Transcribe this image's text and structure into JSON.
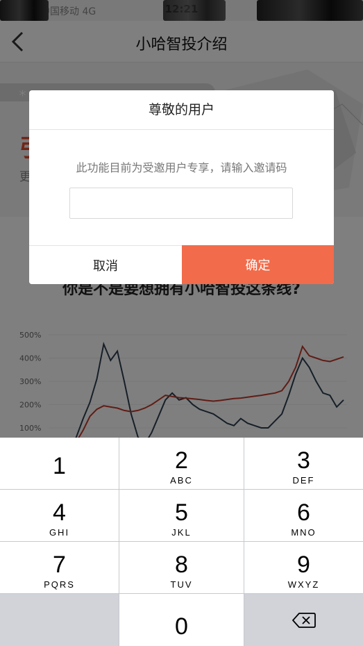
{
  "status_bar": {
    "carrier": "中国移动  4G",
    "time": "12:21"
  },
  "nav": {
    "title": "小哈智投介绍"
  },
  "banner": {
    "big_text": "引",
    "more_text": "更"
  },
  "content": {
    "headline": "你是不是要想拥有小哈智投这条线?"
  },
  "chart_data": {
    "type": "line",
    "title": "",
    "y_tick_labels": [
      "500%",
      "400%",
      "300%",
      "200%",
      "100%"
    ],
    "ylim": [
      0,
      500
    ],
    "series": [
      {
        "color": "#2c3e50",
        "values": [
          20,
          60,
          140,
          210,
          310,
          460,
          390,
          430,
          300,
          160,
          60,
          30,
          80,
          150,
          220,
          250,
          220,
          230,
          200,
          180,
          170,
          160,
          140,
          120,
          110,
          140,
          120,
          110,
          100,
          100,
          130,
          160,
          240,
          330,
          400,
          360,
          300,
          250,
          240,
          190,
          220
        ]
      },
      {
        "color": "#c0392b",
        "values": [
          10,
          40,
          90,
          150,
          180,
          195,
          190,
          185,
          175,
          170,
          175,
          185,
          200,
          220,
          240,
          235,
          230,
          228,
          225,
          222,
          218,
          215,
          218,
          222,
          226,
          228,
          232,
          236,
          240,
          245,
          250,
          260,
          300,
          360,
          450,
          410,
          400,
          390,
          385,
          395,
          405
        ]
      }
    ],
    "colors": {
      "series_dark": "#2c3e50",
      "series_red": "#c0392b"
    }
  },
  "dialog": {
    "title": "尊敬的用户",
    "message": "此功能目前为受邀用户专享，请输入邀请码",
    "input_value": "",
    "cancel_label": "取消",
    "confirm_label": "确定",
    "confirm_color": "#f26b4a"
  },
  "keypad": {
    "keys": [
      {
        "digit": "1",
        "letters": ""
      },
      {
        "digit": "2",
        "letters": "ABC"
      },
      {
        "digit": "3",
        "letters": "DEF"
      },
      {
        "digit": "4",
        "letters": "GHI"
      },
      {
        "digit": "5",
        "letters": "JKL"
      },
      {
        "digit": "6",
        "letters": "MNO"
      },
      {
        "digit": "7",
        "letters": "PQRS"
      },
      {
        "digit": "8",
        "letters": "TUV"
      },
      {
        "digit": "9",
        "letters": "WXYZ"
      },
      {
        "digit": "0",
        "letters": ""
      }
    ],
    "delete_icon": "backspace-icon"
  }
}
